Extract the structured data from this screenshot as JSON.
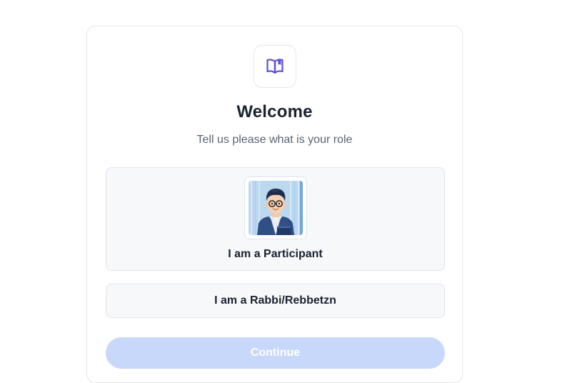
{
  "colors": {
    "accent": "#5b4fd6",
    "button_disabled_bg": "#c8d8fb",
    "button_disabled_text": "#ffffff",
    "option_bg": "#f7f8fa",
    "border": "#dfe3ea"
  },
  "header": {
    "logo_icon": "open-book-icon",
    "title": "Welcome",
    "subtitle": "Tell us please what is your role"
  },
  "roles": [
    {
      "label": "I am a Participant",
      "avatar": "participant-avatar"
    },
    {
      "label": "I am a Rabbi/Rebbetzn"
    }
  ],
  "actions": {
    "continue_label": "Continue",
    "continue_disabled": true
  }
}
